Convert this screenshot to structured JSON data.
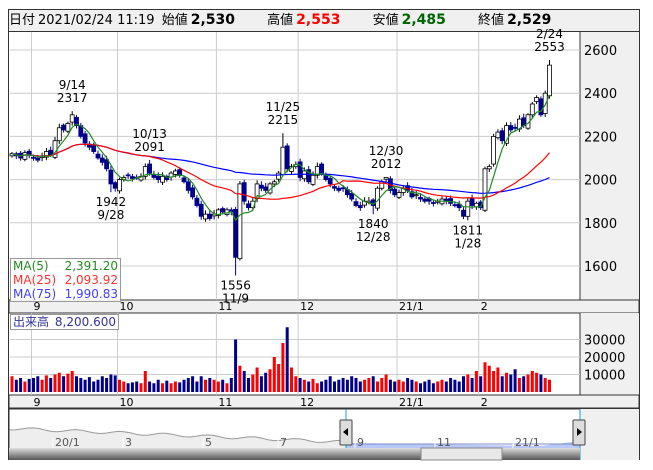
{
  "header": {
    "date_label": "日付",
    "datetime": "2021/02/24 11:19",
    "open_label": "始値",
    "open": "2,530",
    "high_label": "高値",
    "high": "2,553",
    "low_label": "安値",
    "low": "2,485",
    "close_label": "終値",
    "close": "2,529"
  },
  "colors": {
    "up": "#ffffff",
    "down": "#00008b",
    "ma5": "#228b22",
    "ma25": "#ff0000",
    "ma75": "#0000ff",
    "vol_up": "#ff0000",
    "vol_down": "#00008b",
    "nav_fill": "#b8c8f8",
    "high_text": "#ff0000",
    "low_text": "#006400"
  },
  "ma_legend": [
    {
      "label": "MA(5)",
      "value": "2,391.20"
    },
    {
      "label": "MA(25)",
      "value": "2,093.92"
    },
    {
      "label": "MA(75)",
      "value": "1,990.83"
    }
  ],
  "volume_legend": {
    "label": "出来高",
    "value": "8,200.600"
  },
  "price_axis": {
    "ticks": [
      2600,
      2400,
      2200,
      2000,
      1800,
      1600
    ],
    "labels": [
      "2600",
      "2400",
      "2200",
      "2000",
      "1800",
      "1600"
    ]
  },
  "volume_axis": {
    "ticks": [
      30000,
      20000,
      10000
    ],
    "labels": [
      "30000",
      "20000",
      "10000"
    ]
  },
  "month_labels": [
    {
      "label": "9",
      "day": 5
    },
    {
      "label": "10",
      "day": 25
    },
    {
      "label": "11",
      "day": 48
    },
    {
      "label": "12",
      "day": 67
    },
    {
      "label": "21/1",
      "day": 90
    },
    {
      "label": "2",
      "day": 109
    }
  ],
  "annotations": [
    {
      "date": "9/14",
      "price": "2317",
      "day": 14,
      "pos": "above"
    },
    {
      "date": "10/13",
      "price": "2091",
      "day": 32,
      "pos": "above"
    },
    {
      "date": "11/25",
      "price": "2215",
      "day": 63,
      "pos": "above"
    },
    {
      "date": "12/30",
      "price": "2012",
      "day": 87,
      "pos": "above"
    },
    {
      "date": "2/24",
      "price": "2553",
      "day": 125,
      "pos": "above"
    },
    {
      "date": "9/28",
      "price": "1942",
      "day": 23,
      "pos": "below"
    },
    {
      "date": "11/9",
      "price": "1556",
      "day": 52,
      "pos": "below"
    },
    {
      "date": "12/28",
      "price": "1840",
      "day": 84,
      "pos": "below"
    },
    {
      "date": "1/28",
      "price": "1811",
      "day": 106,
      "pos": "below"
    }
  ],
  "closes": [
    2120,
    2110,
    2100,
    2125,
    2115,
    2100,
    2090,
    2110,
    2130,
    2115,
    2180,
    2240,
    2230,
    2260,
    2300,
    2250,
    2200,
    2170,
    2150,
    2130,
    2100,
    2080,
    2050,
    1980,
    1960,
    2000,
    2010,
    2020,
    2005,
    2010,
    2015,
    2060,
    2030,
    2010,
    2000,
    2015,
    2000,
    2030,
    2040,
    2020,
    1990,
    1950,
    1920,
    1880,
    1830,
    1840,
    1820,
    1840,
    1860,
    1850,
    1860,
    1850,
    1640,
    1980,
    1900,
    1870,
    1900,
    1980,
    1960,
    1950,
    1980,
    1990,
    2030,
    2150,
    2050,
    2060,
    2070,
    2010,
    2040,
    1990,
    2020,
    2060,
    2030,
    2000,
    1980,
    1960,
    1950,
    1960,
    1930,
    1910,
    1880,
    1870,
    1900,
    1900,
    1880,
    1960,
    1990,
    2010,
    1950,
    1930,
    1940,
    1960,
    1950,
    1920,
    1930,
    1910,
    1900,
    1900,
    1890,
    1900,
    1910,
    1900,
    1890,
    1880,
    1870,
    1830,
    1900,
    1880,
    1890,
    1870,
    2050,
    2060,
    2200,
    2220,
    2180,
    2250,
    2230,
    2240,
    2280,
    2250,
    2300,
    2350,
    2380,
    2300,
    2400,
    2530
  ],
  "volumes": [
    9000,
    7000,
    8000,
    6000,
    7500,
    8000,
    9000,
    7000,
    9500,
    8000,
    10000,
    11000,
    9000,
    10500,
    12000,
    9000,
    8000,
    7000,
    8500,
    6000,
    7000,
    9000,
    8000,
    10000,
    9500,
    7000,
    6000,
    5000,
    5500,
    6000,
    5000,
    12000,
    6000,
    5000,
    7000,
    5000,
    6500,
    5000,
    6000,
    5500,
    7000,
    8000,
    9000,
    6000,
    9000,
    7000,
    8000,
    7000,
    6000,
    7000,
    5000,
    8000,
    30000,
    15000,
    12000,
    8000,
    10000,
    14000,
    9000,
    11000,
    13000,
    20000,
    16000,
    28000,
    37000,
    14000,
    9000,
    8000,
    7000,
    6000,
    7500,
    5000,
    6000,
    7000,
    9000,
    6000,
    7000,
    8000,
    7000,
    9000,
    8000,
    6000,
    7000,
    8000,
    9000,
    6000,
    8000,
    10000,
    7000,
    6000,
    7000,
    6000,
    8000,
    7000,
    6000,
    5000,
    6000,
    7000,
    5000,
    6000,
    7000,
    6000,
    8000,
    7000,
    6000,
    9000,
    10000,
    8000,
    12000,
    9000,
    17000,
    15000,
    12000,
    14000,
    9000,
    11000,
    10000,
    13000,
    8000,
    9000,
    10000,
    12000,
    11000,
    10000,
    8000,
    7000
  ],
  "navigator": {
    "labels": [
      "20/1",
      "3",
      "5",
      "7",
      "9",
      "11",
      "21/1"
    ]
  }
}
